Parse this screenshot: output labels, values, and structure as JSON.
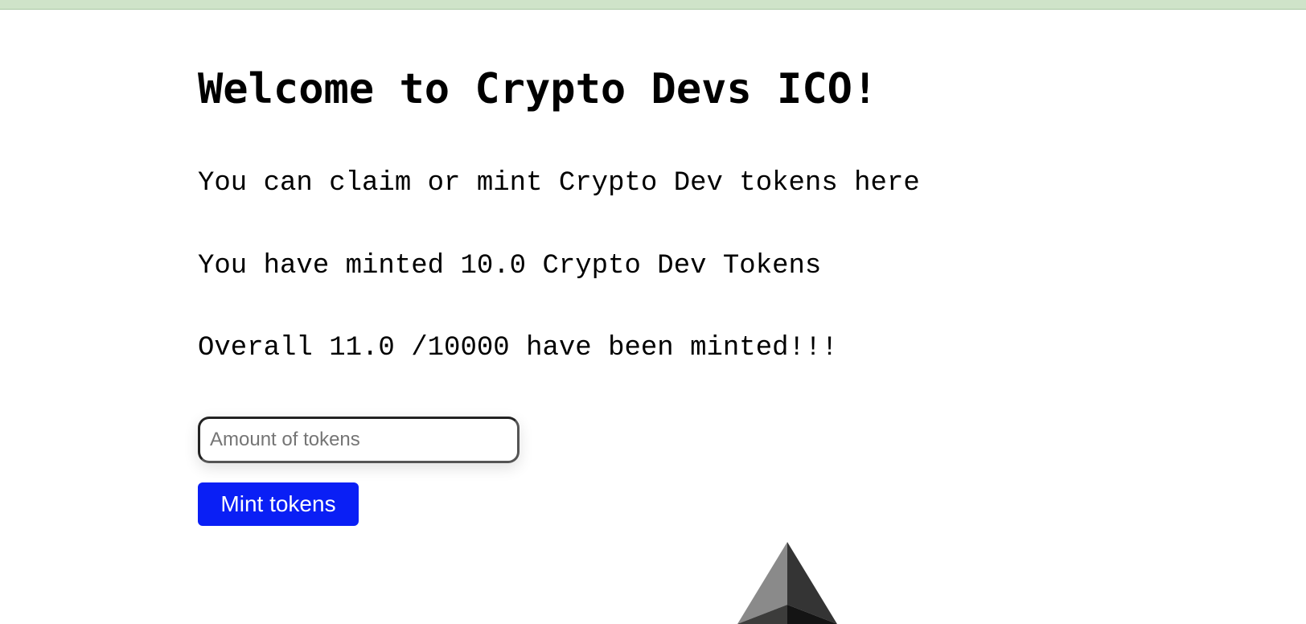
{
  "page": {
    "title": "Welcome to Crypto Devs ICO!",
    "description": "You can claim or mint Crypto Dev tokens here",
    "minted_by_user": "You have minted 10.0 Crypto Dev Tokens",
    "overall_minted": "Overall 11.0 /10000 have been minted!!!"
  },
  "mint_form": {
    "amount_placeholder": "Amount of tokens",
    "amount_value": "",
    "mint_button_label": "Mint tokens"
  },
  "colors": {
    "top_bar": "#cfe3c9",
    "button_bg": "#0a1ff5",
    "button_text": "#ffffff"
  },
  "icons": {
    "logo": "ethereum-logo-icon"
  }
}
